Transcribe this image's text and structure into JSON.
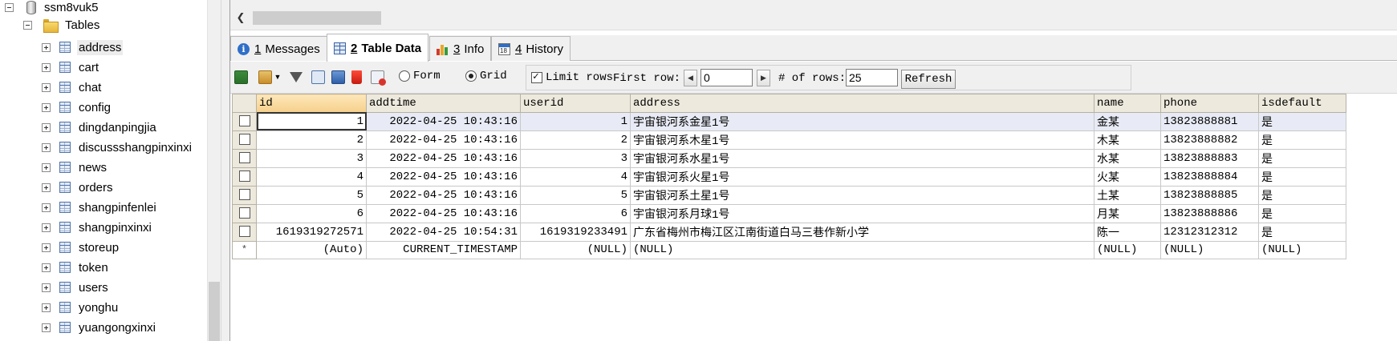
{
  "tree": {
    "database": "ssm8vuk5",
    "folder": "Tables",
    "selected": "address",
    "tables": [
      "address",
      "cart",
      "chat",
      "config",
      "dingdanpingjia",
      "discussshangpinxinxi",
      "news",
      "orders",
      "shangpinfenlei",
      "shangpinxinxi",
      "storeup",
      "token",
      "users",
      "yonghu",
      "yuangongxinxi"
    ]
  },
  "tabs": [
    {
      "num": "1",
      "label": "Messages",
      "icon": "info-icon",
      "active": false
    },
    {
      "num": "2",
      "label": "Table Data",
      "icon": "table-grid-icon",
      "active": true
    },
    {
      "num": "3",
      "label": "Info",
      "icon": "bar-chart-icon",
      "active": false
    },
    {
      "num": "4",
      "label": "History",
      "icon": "calendar-icon",
      "active": false
    }
  ],
  "toolbar": {
    "view_form": "Form",
    "view_grid": "Grid",
    "selected_view": "Grid",
    "limit_rows_label": "Limit rows",
    "limit_rows_checked": true,
    "first_row_label": "First row:",
    "first_row_value": "0",
    "num_rows_label": "# of rows:",
    "num_rows_value": "25",
    "refresh_label": "Refresh"
  },
  "grid": {
    "columns": [
      "id",
      "addtime",
      "userid",
      "address",
      "name",
      "phone",
      "isdefault"
    ],
    "rows": [
      [
        "1",
        "2022-04-25 10:43:16",
        "1",
        "宇宙银河系金星1号",
        "金某",
        "13823888881",
        "是"
      ],
      [
        "2",
        "2022-04-25 10:43:16",
        "2",
        "宇宙银河系木星1号",
        "木某",
        "13823888882",
        "是"
      ],
      [
        "3",
        "2022-04-25 10:43:16",
        "3",
        "宇宙银河系水星1号",
        "水某",
        "13823888883",
        "是"
      ],
      [
        "4",
        "2022-04-25 10:43:16",
        "4",
        "宇宙银河系火星1号",
        "火某",
        "13823888884",
        "是"
      ],
      [
        "5",
        "2022-04-25 10:43:16",
        "5",
        "宇宙银河系土星1号",
        "土某",
        "13823888885",
        "是"
      ],
      [
        "6",
        "2022-04-25 10:43:16",
        "6",
        "宇宙银河系月球1号",
        "月某",
        "13823888886",
        "是"
      ],
      [
        "1619319272571",
        "2022-04-25 10:54:31",
        "1619319233491",
        "广东省梅州市梅江区江南街道白马三巷作新小学",
        "陈一",
        "12312312312",
        "是"
      ]
    ],
    "new_row": [
      "(Auto)",
      "CURRENT_TIMESTAMP",
      "(NULL)",
      "(NULL)",
      "(NULL)",
      "(NULL)",
      "(NULL)"
    ],
    "new_row_marker": "*"
  },
  "colors": {
    "header_bg": "#ede9dd",
    "selected_header": "#f6d08b",
    "selected_row": "#e8ebf5",
    "panel_bg": "#f0f0f0"
  }
}
